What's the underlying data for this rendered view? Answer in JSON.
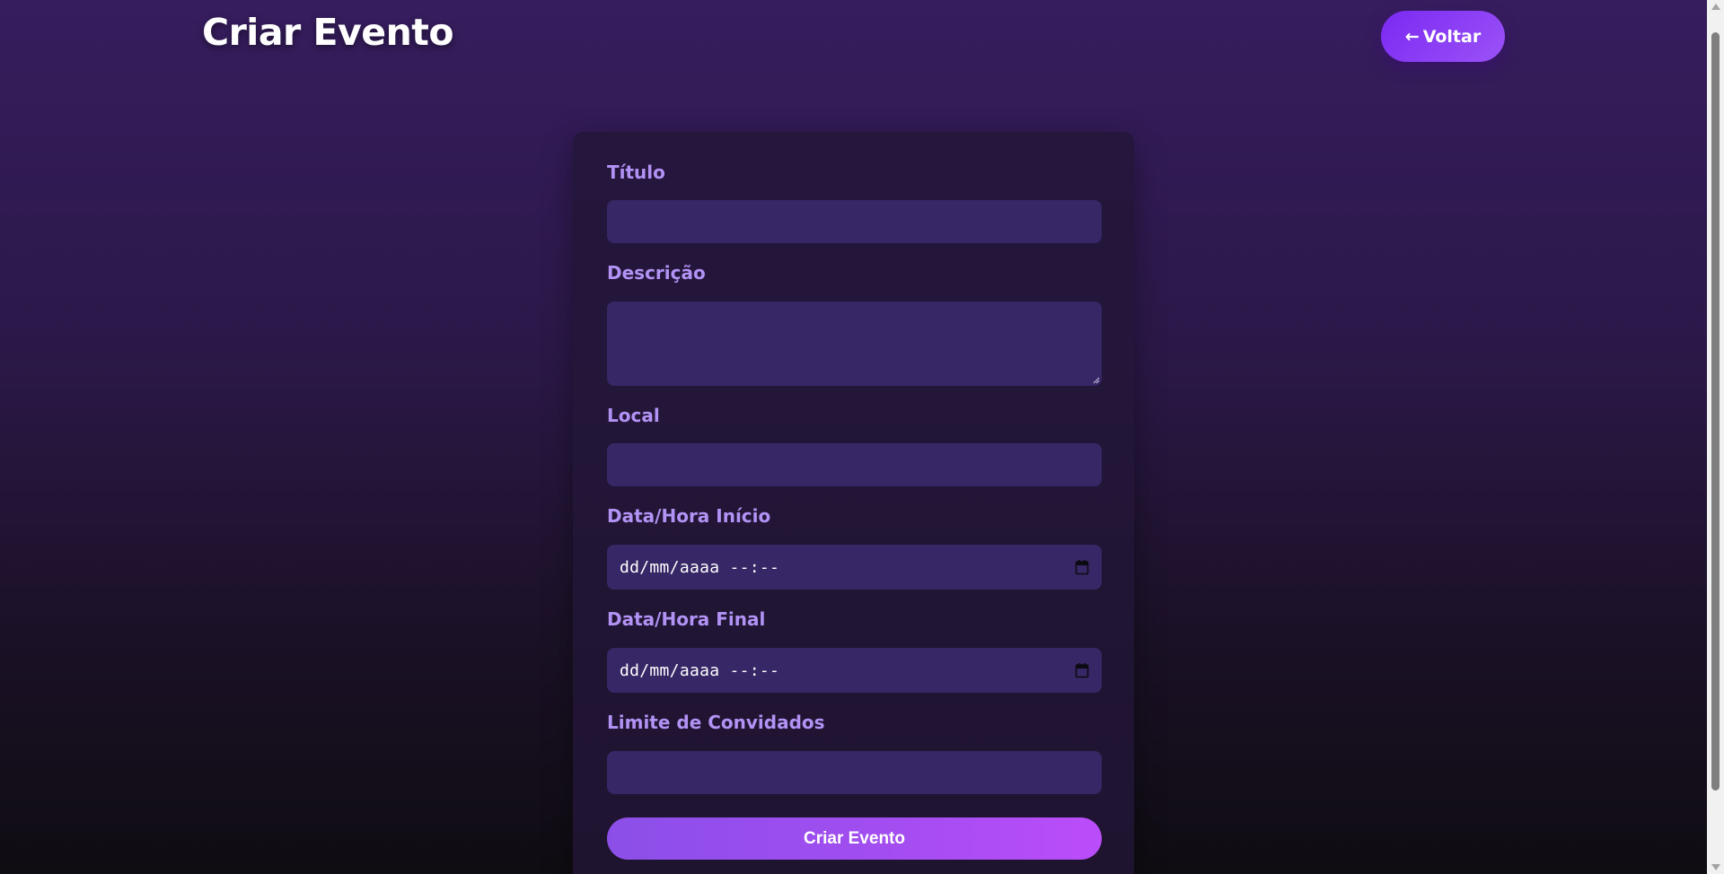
{
  "header": {
    "title": "Criar Evento",
    "back_button": {
      "arrow": "←",
      "label": "Voltar",
      "icon": "arrow-left-icon"
    }
  },
  "form": {
    "fields": [
      {
        "label": "Título",
        "type": "text",
        "value": ""
      },
      {
        "label": "Descrição",
        "type": "textarea",
        "value": ""
      },
      {
        "label": "Local",
        "type": "text",
        "value": ""
      },
      {
        "label": "Data/Hora Início",
        "type": "datetime-local",
        "display": "dd/mm/aaaa --:--",
        "icon": "calendar-icon"
      },
      {
        "label": "Data/Hora Final",
        "type": "datetime-local",
        "display": "dd/mm/aaaa --:--",
        "icon": "calendar-icon"
      },
      {
        "label": "Limite de Convidados",
        "type": "number",
        "value": ""
      }
    ],
    "submit_label": "Criar Evento"
  },
  "colors": {
    "accent": "#7a29f2",
    "label": "#b293f5",
    "input_background": "#372766",
    "submit_gradient_end": "#bb4dfa"
  }
}
